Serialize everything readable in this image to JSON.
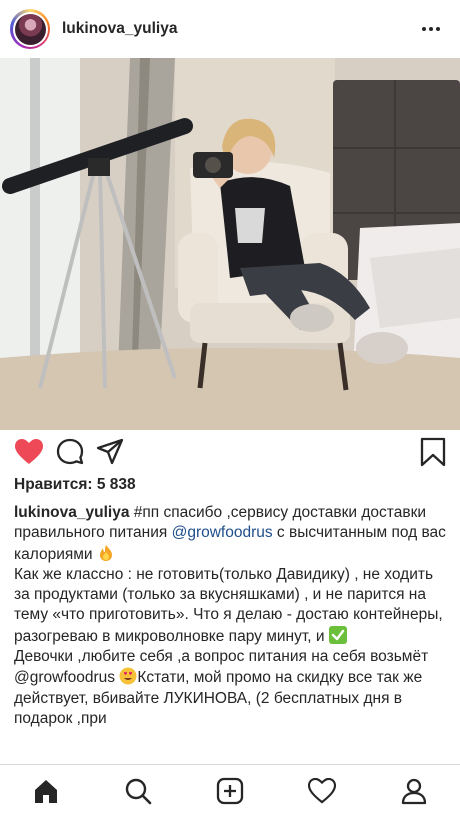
{
  "header": {
    "username": "lukinova_yuliya",
    "avatar_icon": "profile-avatar",
    "more_icon": "more-dots-icon"
  },
  "post": {
    "image_description_icon": "post-photo",
    "actions": {
      "like_icon": "heart-filled-icon",
      "like_color": "#ed4956",
      "comment_icon": "comment-icon",
      "share_icon": "share-icon",
      "save_icon": "bookmark-icon"
    },
    "likes_text": "Нравится: 5 838",
    "caption": {
      "username": "lukinova_yuliya",
      "line1": " #пп спасибо ,сервису доставки доставки правильного питания ",
      "mention1": "@growfoodrus",
      "line1_end": " с высчитанным под вас калориями ",
      "para2": "Как же классно : не готовить(только Давидику) , не ходить за продуктами (только за вкусняшками) , и не парится на тему «что приготовить». Что я делаю - достаю контейнеры, разогреваю в микроволновке пару минут, и ",
      "para3_start": "Девочки ,любите себя ,а вопрос питания на себя возьмёт @growfoodrus ",
      "para3_end": "Кстати, мой промо на скидку все так же действует, вбивайте ЛУКИНОВА, (2 бесплатных дня в подарок ,при"
    }
  },
  "bottom_nav": {
    "items": [
      "home-icon",
      "search-icon",
      "add-post-icon",
      "activity-heart-icon",
      "profile-icon"
    ]
  }
}
